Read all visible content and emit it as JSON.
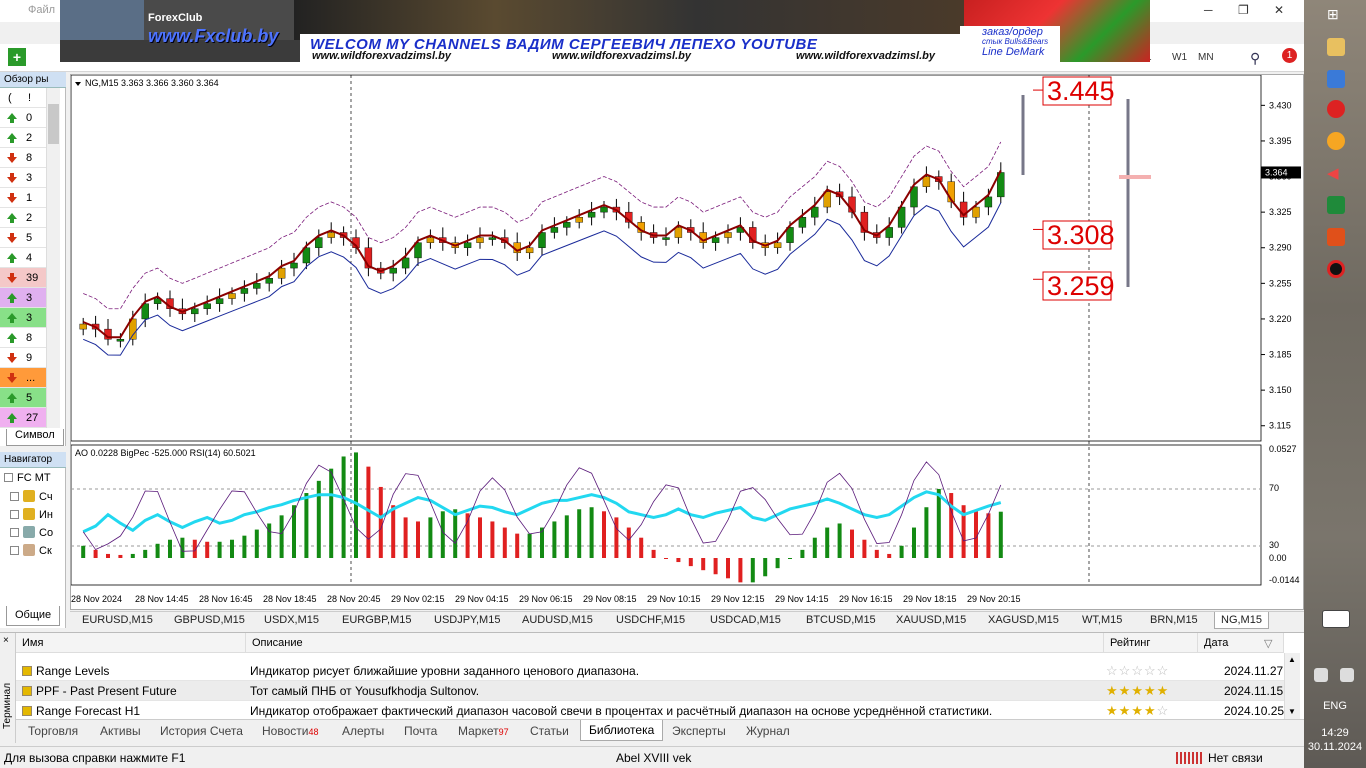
{
  "window": {
    "menu_first": "Файл",
    "controls": [
      "─",
      "❐",
      "✕"
    ]
  },
  "banner": {
    "fxclub_logo": "ForexClub",
    "fxclub_url": "www.Fxclub.by",
    "welcome": "WELCOM MY CHANNELS ВАДИМ СЕРГЕЕВИЧ ЛЕПЕХО YOUTUBE",
    "site1": "www.wildforexvadzimsl.by",
    "site2": "www.wildforexvadzimsl.by",
    "site3": "www.wildforexvadzimsl.by",
    "order1": "заказ/ордер",
    "order2": "стык Bulls&Bears",
    "order3": "Line DeMark"
  },
  "toolbar": {
    "tf_w1": "W1",
    "tf_mn": "MN",
    "partial": "1",
    "notif": "1"
  },
  "market_watch": {
    "title": "Обзор ры",
    "header": [
      "(",
      "!"
    ],
    "rows": [
      {
        "val": "0",
        "dir": "up",
        "bg": ""
      },
      {
        "val": "2",
        "dir": "up",
        "bg": ""
      },
      {
        "val": "8",
        "dir": "down",
        "bg": ""
      },
      {
        "val": "3",
        "dir": "down",
        "bg": ""
      },
      {
        "val": "1",
        "dir": "down",
        "bg": ""
      },
      {
        "val": "2",
        "dir": "up",
        "bg": ""
      },
      {
        "val": "5",
        "dir": "down",
        "bg": ""
      },
      {
        "val": "4",
        "dir": "up",
        "bg": ""
      },
      {
        "val": "39",
        "dir": "down",
        "bg": "#f4c8c8"
      },
      {
        "val": "3",
        "dir": "up",
        "bg": "#e0b0f0"
      },
      {
        "val": "3",
        "dir": "up",
        "bg": "#88e088"
      },
      {
        "val": "8",
        "dir": "up",
        "bg": ""
      },
      {
        "val": "9",
        "dir": "down",
        "bg": ""
      },
      {
        "val": "...",
        "dir": "down",
        "bg": "#ff9a3a"
      },
      {
        "val": "5",
        "dir": "up",
        "bg": "#88e088"
      },
      {
        "val": "27",
        "dir": "up",
        "bg": "#f0b0f0"
      }
    ],
    "tab": "Символ"
  },
  "navigator": {
    "title": "Навигатор",
    "items": [
      "FC MT",
      "Сч",
      "Ин",
      "Со",
      "Ск"
    ],
    "tab": "Общие"
  },
  "chart_data": {
    "type": "candlestick",
    "symbol_header": "NG,M15  3.363 3.366 3.360 3.364",
    "ylim": [
      3.1,
      3.45
    ],
    "y_ticks": [
      "3.430",
      "3.395",
      "3.360",
      "3.325",
      "3.290",
      "3.255",
      "3.220",
      "3.185",
      "3.150",
      "3.115"
    ],
    "current_price": "3.364",
    "level_high": "3.445",
    "level_mid": "3.308",
    "level_low": "3.259",
    "x_labels": [
      "28 Nov 2024",
      "28 Nov 14:45",
      "28 Nov 16:45",
      "28 Nov 18:45",
      "28 Nov 20:45",
      "29 Nov 02:15",
      "29 Nov 04:15",
      "29 Nov 06:15",
      "29 Nov 08:15",
      "29 Nov 10:15",
      "29 Nov 12:15",
      "29 Nov 14:15",
      "29 Nov 16:15",
      "29 Nov 18:15",
      "29 Nov 20:15"
    ],
    "close": [
      3.215,
      3.21,
      3.2,
      3.2,
      3.22,
      3.235,
      3.24,
      3.23,
      3.225,
      3.23,
      3.235,
      3.24,
      3.245,
      3.25,
      3.255,
      3.26,
      3.27,
      3.275,
      3.29,
      3.3,
      3.305,
      3.3,
      3.29,
      3.27,
      3.265,
      3.27,
      3.28,
      3.295,
      3.3,
      3.295,
      3.29,
      3.295,
      3.3,
      3.3,
      3.295,
      3.285,
      3.29,
      3.305,
      3.31,
      3.315,
      3.32,
      3.325,
      3.33,
      3.325,
      3.315,
      3.305,
      3.3,
      3.3,
      3.31,
      3.305,
      3.295,
      3.3,
      3.305,
      3.31,
      3.295,
      3.29,
      3.295,
      3.31,
      3.32,
      3.33,
      3.345,
      3.34,
      3.325,
      3.305,
      3.3,
      3.31,
      3.33,
      3.35,
      3.36,
      3.355,
      3.335,
      3.32,
      3.33,
      3.34,
      3.364
    ],
    "indicator_header": "AO 0.0228  BigPec -525.000  RSI(14) 60.5021",
    "sub_y_ticks": [
      "0.0527",
      "70",
      "30",
      "0.00",
      "-0.0144"
    ],
    "ao": [
      0.006,
      0.004,
      0.002,
      0.0015,
      0.002,
      0.004,
      0.007,
      0.009,
      0.01,
      0.009,
      0.008,
      0.008,
      0.009,
      0.011,
      0.014,
      0.017,
      0.021,
      0.026,
      0.032,
      0.038,
      0.044,
      0.05,
      0.052,
      0.045,
      0.035,
      0.026,
      0.02,
      0.018,
      0.02,
      0.023,
      0.024,
      0.022,
      0.02,
      0.018,
      0.015,
      0.012,
      0.012,
      0.015,
      0.018,
      0.021,
      0.024,
      0.025,
      0.023,
      0.02,
      0.015,
      0.01,
      0.004,
      0.0,
      -0.002,
      -0.004,
      -0.006,
      -0.008,
      -0.01,
      -0.012,
      -0.012,
      -0.009,
      -0.005,
      0.0,
      0.004,
      0.01,
      0.015,
      0.017,
      0.014,
      0.009,
      0.004,
      0.002,
      0.006,
      0.015,
      0.025,
      0.034,
      0.032,
      0.026,
      0.023,
      0.022,
      0.0228
    ],
    "rsi": [
      40,
      44,
      52,
      46,
      41,
      48,
      52,
      47,
      43,
      47,
      50,
      46,
      48,
      52,
      54,
      57,
      59,
      62,
      64,
      66,
      66,
      64,
      60,
      55,
      50,
      56,
      60,
      64,
      62,
      57,
      52,
      55,
      58,
      57,
      54,
      52,
      56,
      60,
      62,
      62,
      64,
      66,
      64,
      60,
      54,
      52,
      50,
      52,
      56,
      52,
      50,
      53,
      55,
      57,
      50,
      48,
      52,
      56,
      58,
      60,
      63,
      60,
      56,
      52,
      50,
      52,
      58,
      64,
      68,
      66,
      58,
      52,
      55,
      58,
      60.5021
    ]
  },
  "symbol_tabs": [
    "EURUSD,M15",
    "GBPUSD,M15",
    "USDX,M15",
    "EURGBP,M15",
    "USDJPY,M15",
    "AUDUSD,M15",
    "USDCHF,M15",
    "USDCAD,M15",
    "BTCUSD,M15",
    "XAUUSD,M15",
    "XAGUSD,M15",
    "WT,M15",
    "BRN,M15",
    "NG,M15"
  ],
  "terminal": {
    "side_label": "Терминал",
    "cols": {
      "name": "Имя",
      "desc": "Описание",
      "rating": "Рейтинг",
      "date": "Дата"
    },
    "rows": [
      {
        "name": "Range Levels",
        "desc": "Индикатор рисует ближайшие уровни заданного ценового диапазона.",
        "rating": 0,
        "date": "2024.11.27"
      },
      {
        "name": "PPF - Past Present Future",
        "desc": "Тот самый ПНБ от Yousufkhodja Sultonov.",
        "rating": 4.5,
        "date": "2024.11.15"
      },
      {
        "name": "Range Forecast H1",
        "desc": "Индикатор отображает фактический диапазон часовой свечи в процентах и расчётный диапазон на основе усреднённой статистики.",
        "rating": 3.5,
        "date": "2024.10.25"
      }
    ],
    "tabs": [
      {
        "label": "Торговля",
        "badge": ""
      },
      {
        "label": "Активы",
        "badge": ""
      },
      {
        "label": "История Счета",
        "badge": ""
      },
      {
        "label": "Новости",
        "badge": "48"
      },
      {
        "label": "Алерты",
        "badge": ""
      },
      {
        "label": "Почта",
        "badge": ""
      },
      {
        "label": "Маркет",
        "badge": "97"
      },
      {
        "label": "Статьи",
        "badge": ""
      },
      {
        "label": "Библиотека",
        "badge": ""
      },
      {
        "label": "Эксперты",
        "badge": ""
      },
      {
        "label": "Журнал",
        "badge": ""
      }
    ]
  },
  "status": {
    "help": "Для вызова справки нажмите F1",
    "profile": "Abel XVIII vek",
    "connection": "Нет связи"
  },
  "taskbar": {
    "lang": "ENG",
    "time": "14:29",
    "date": "30.11.2024"
  }
}
